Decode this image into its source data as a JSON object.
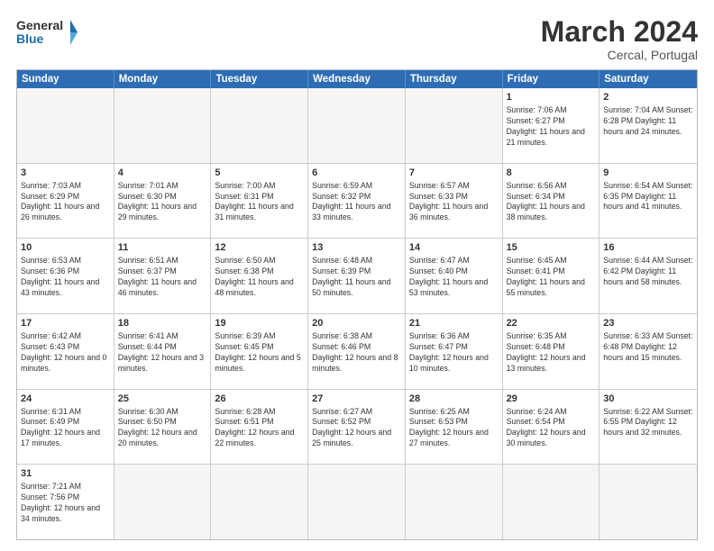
{
  "header": {
    "logo_general": "General",
    "logo_blue": "Blue",
    "title": "March 2024",
    "subtitle": "Cercal, Portugal"
  },
  "days_of_week": [
    "Sunday",
    "Monday",
    "Tuesday",
    "Wednesday",
    "Thursday",
    "Friday",
    "Saturday"
  ],
  "weeks": [
    [
      {
        "num": "",
        "info": ""
      },
      {
        "num": "",
        "info": ""
      },
      {
        "num": "",
        "info": ""
      },
      {
        "num": "",
        "info": ""
      },
      {
        "num": "",
        "info": ""
      },
      {
        "num": "1",
        "info": "Sunrise: 7:06 AM\nSunset: 6:27 PM\nDaylight: 11 hours\nand 21 minutes."
      },
      {
        "num": "2",
        "info": "Sunrise: 7:04 AM\nSunset: 6:28 PM\nDaylight: 11 hours\nand 24 minutes."
      }
    ],
    [
      {
        "num": "3",
        "info": "Sunrise: 7:03 AM\nSunset: 6:29 PM\nDaylight: 11 hours\nand 26 minutes."
      },
      {
        "num": "4",
        "info": "Sunrise: 7:01 AM\nSunset: 6:30 PM\nDaylight: 11 hours\nand 29 minutes."
      },
      {
        "num": "5",
        "info": "Sunrise: 7:00 AM\nSunset: 6:31 PM\nDaylight: 11 hours\nand 31 minutes."
      },
      {
        "num": "6",
        "info": "Sunrise: 6:59 AM\nSunset: 6:32 PM\nDaylight: 11 hours\nand 33 minutes."
      },
      {
        "num": "7",
        "info": "Sunrise: 6:57 AM\nSunset: 6:33 PM\nDaylight: 11 hours\nand 36 minutes."
      },
      {
        "num": "8",
        "info": "Sunrise: 6:56 AM\nSunset: 6:34 PM\nDaylight: 11 hours\nand 38 minutes."
      },
      {
        "num": "9",
        "info": "Sunrise: 6:54 AM\nSunset: 6:35 PM\nDaylight: 11 hours\nand 41 minutes."
      }
    ],
    [
      {
        "num": "10",
        "info": "Sunrise: 6:53 AM\nSunset: 6:36 PM\nDaylight: 11 hours\nand 43 minutes."
      },
      {
        "num": "11",
        "info": "Sunrise: 6:51 AM\nSunset: 6:37 PM\nDaylight: 11 hours\nand 46 minutes."
      },
      {
        "num": "12",
        "info": "Sunrise: 6:50 AM\nSunset: 6:38 PM\nDaylight: 11 hours\nand 48 minutes."
      },
      {
        "num": "13",
        "info": "Sunrise: 6:48 AM\nSunset: 6:39 PM\nDaylight: 11 hours\nand 50 minutes."
      },
      {
        "num": "14",
        "info": "Sunrise: 6:47 AM\nSunset: 6:40 PM\nDaylight: 11 hours\nand 53 minutes."
      },
      {
        "num": "15",
        "info": "Sunrise: 6:45 AM\nSunset: 6:41 PM\nDaylight: 11 hours\nand 55 minutes."
      },
      {
        "num": "16",
        "info": "Sunrise: 6:44 AM\nSunset: 6:42 PM\nDaylight: 11 hours\nand 58 minutes."
      }
    ],
    [
      {
        "num": "17",
        "info": "Sunrise: 6:42 AM\nSunset: 6:43 PM\nDaylight: 12 hours\nand 0 minutes."
      },
      {
        "num": "18",
        "info": "Sunrise: 6:41 AM\nSunset: 6:44 PM\nDaylight: 12 hours\nand 3 minutes."
      },
      {
        "num": "19",
        "info": "Sunrise: 6:39 AM\nSunset: 6:45 PM\nDaylight: 12 hours\nand 5 minutes."
      },
      {
        "num": "20",
        "info": "Sunrise: 6:38 AM\nSunset: 6:46 PM\nDaylight: 12 hours\nand 8 minutes."
      },
      {
        "num": "21",
        "info": "Sunrise: 6:36 AM\nSunset: 6:47 PM\nDaylight: 12 hours\nand 10 minutes."
      },
      {
        "num": "22",
        "info": "Sunrise: 6:35 AM\nSunset: 6:48 PM\nDaylight: 12 hours\nand 13 minutes."
      },
      {
        "num": "23",
        "info": "Sunrise: 6:33 AM\nSunset: 6:48 PM\nDaylight: 12 hours\nand 15 minutes."
      }
    ],
    [
      {
        "num": "24",
        "info": "Sunrise: 6:31 AM\nSunset: 6:49 PM\nDaylight: 12 hours\nand 17 minutes."
      },
      {
        "num": "25",
        "info": "Sunrise: 6:30 AM\nSunset: 6:50 PM\nDaylight: 12 hours\nand 20 minutes."
      },
      {
        "num": "26",
        "info": "Sunrise: 6:28 AM\nSunset: 6:51 PM\nDaylight: 12 hours\nand 22 minutes."
      },
      {
        "num": "27",
        "info": "Sunrise: 6:27 AM\nSunset: 6:52 PM\nDaylight: 12 hours\nand 25 minutes."
      },
      {
        "num": "28",
        "info": "Sunrise: 6:25 AM\nSunset: 6:53 PM\nDaylight: 12 hours\nand 27 minutes."
      },
      {
        "num": "29",
        "info": "Sunrise: 6:24 AM\nSunset: 6:54 PM\nDaylight: 12 hours\nand 30 minutes."
      },
      {
        "num": "30",
        "info": "Sunrise: 6:22 AM\nSunset: 6:55 PM\nDaylight: 12 hours\nand 32 minutes."
      }
    ],
    [
      {
        "num": "31",
        "info": "Sunrise: 7:21 AM\nSunset: 7:56 PM\nDaylight: 12 hours\nand 34 minutes."
      },
      {
        "num": "",
        "info": ""
      },
      {
        "num": "",
        "info": ""
      },
      {
        "num": "",
        "info": ""
      },
      {
        "num": "",
        "info": ""
      },
      {
        "num": "",
        "info": ""
      },
      {
        "num": "",
        "info": ""
      }
    ]
  ]
}
